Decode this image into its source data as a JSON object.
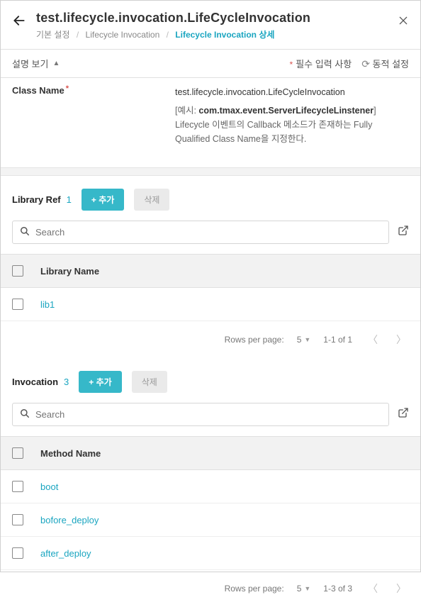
{
  "header": {
    "title": "test.lifecycle.invocation.LifeCycleInvocation",
    "breadcrumb": {
      "c1": "기본 설정",
      "c2": "Lifecycle Invocation",
      "c3": "Lifecycle Invocation 상세"
    }
  },
  "subbar": {
    "desc_toggle": "설명 보기",
    "required_label": "필수 입력 사항",
    "dynamic_label": "동적 설정"
  },
  "class_name": {
    "label": "Class Name",
    "value": "test.lifecycle.invocation.LifeCycleInvocation",
    "example_prefix": "[예시: ",
    "example_bold": "com.tmax.event.ServerLifecycleLinstener",
    "example_suffix": "] Lifecycle 이벤트의 Callback 메소드가 존재하는 Fully Qualified Class Name을 지정한다."
  },
  "library": {
    "title": "Library Ref",
    "count": "1",
    "add_label": "+ 추가",
    "del_label": "삭제",
    "search_placeholder": "Search",
    "col_header": "Library Name",
    "rows": {
      "r1": "lib1"
    },
    "pager": {
      "rpp_label": "Rows per page:",
      "rpp_value": "5",
      "range": "1-1 of 1"
    }
  },
  "invocation": {
    "title": "Invocation",
    "count": "3",
    "add_label": "+ 추가",
    "del_label": "삭제",
    "search_placeholder": "Search",
    "col_header": "Method Name",
    "rows": {
      "r1": "boot",
      "r2": "bofore_deploy",
      "r3": "after_deploy"
    },
    "pager": {
      "rpp_label": "Rows per page:",
      "rpp_value": "5",
      "range": "1-3 of 3"
    }
  }
}
